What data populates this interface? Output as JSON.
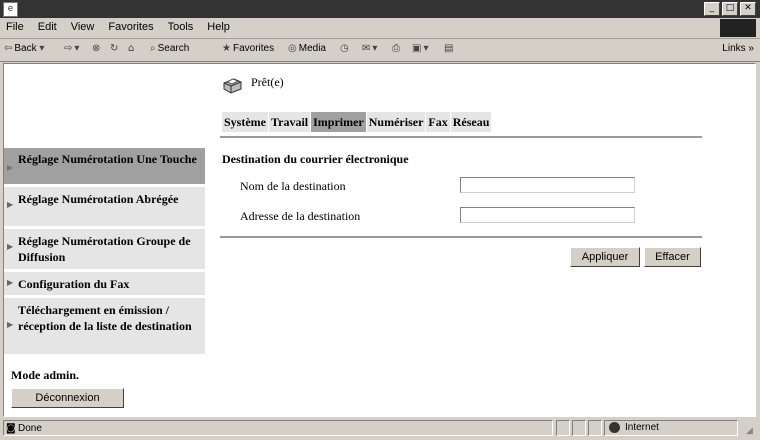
{
  "menu": {
    "items": [
      "File",
      "Edit",
      "View",
      "Favorites",
      "Tools",
      "Help"
    ]
  },
  "toolbar": {
    "back": "Back",
    "search": "Search",
    "favorites": "Favorites",
    "media": "Media",
    "links": "Links"
  },
  "printer": {
    "status": "Prêt(e)"
  },
  "tabs": [
    "Système",
    "Travail",
    "Imprimer",
    "Numériser",
    "Fax",
    "Réseau"
  ],
  "active_tab": "Imprimer",
  "sidebar": {
    "items": [
      "Réglage Numérotation Une Touche",
      "Réglage Numérotation Abrégée",
      "Réglage Numérotation Groupe de Diffusion",
      "Configuration du Fax",
      "Téléchargement en émission / réception de la liste de destination"
    ],
    "admin_label": "Mode admin.",
    "logout": "Déconnexion"
  },
  "form": {
    "title": "Destination du courrier électronique",
    "name_label": "Nom de la destination",
    "name_value": "",
    "address_label": "Adresse de la destination",
    "address_value": "",
    "apply": "Appliquer",
    "clear": "Effacer"
  },
  "statusbar": {
    "text": "Done",
    "zone": "Internet"
  }
}
